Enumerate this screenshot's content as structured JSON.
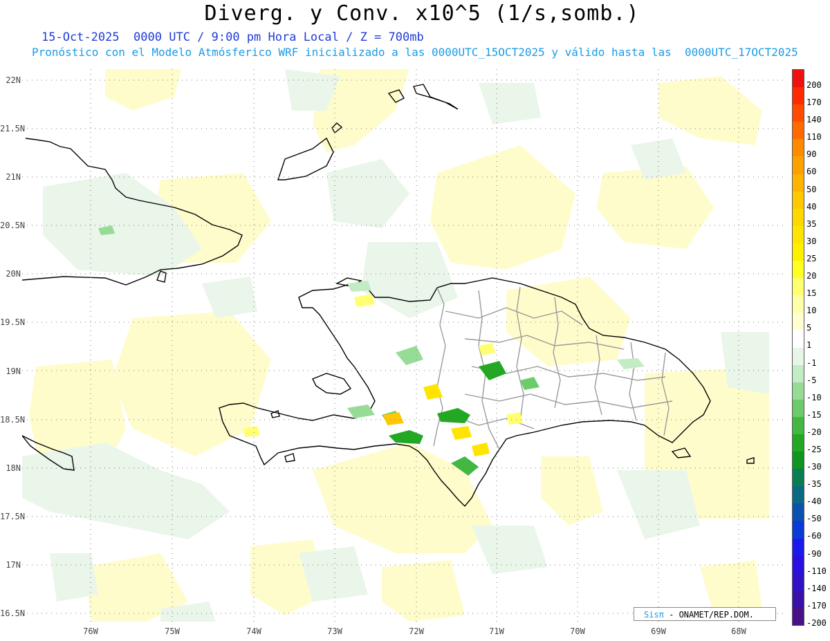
{
  "title": "Diverg. y Conv. x10^5 (1/s,somb.)",
  "subtitle_line1": "15-Oct-2025  0000 UTC / 9:00 pm Hora Local / Z = 700mb",
  "subtitle_line2": "Pronóstico con el Modelo Atmósferico WRF inicializado a las 0000UTC_15OCT2025 y válido hasta las  0000UTC_17OCT2025",
  "lat_labels": [
    "22N",
    "21.5N",
    "21N",
    "20.5N",
    "20N",
    "19.5N",
    "19N",
    "18.5N",
    "18N",
    "17.5N",
    "17N",
    "16.5N"
  ],
  "lon_labels": [
    "76W",
    "75W",
    "74W",
    "73W",
    "72W",
    "71W",
    "70W",
    "69W",
    "68W"
  ],
  "colorbar": {
    "labels": [
      "200",
      "170",
      "140",
      "110",
      "90",
      "60",
      "50",
      "40",
      "35",
      "30",
      "25",
      "20",
      "15",
      "10",
      "5",
      "1",
      "-1",
      "-5",
      "-10",
      "-15",
      "-20",
      "-25",
      "-30",
      "-35",
      "-40",
      "-50",
      "-60",
      "-90",
      "-110",
      "-140",
      "-170",
      "-200"
    ],
    "colors": [
      "#f01010",
      "#ff2a00",
      "#ff4a00",
      "#ff6a00",
      "#ff8a00",
      "#ffa000",
      "#ffb400",
      "#ffc800",
      "#ffd800",
      "#ffe400",
      "#fff000",
      "#ffff20",
      "#ffff70",
      "#ffffa8",
      "#ffffd0",
      "#ffffff",
      "#e8f6e8",
      "#c4ecc4",
      "#96dc96",
      "#6ccc6c",
      "#42b842",
      "#22a822",
      "#10961e",
      "#0a7e52",
      "#0a6a82",
      "#0a52b0",
      "#0a3ad8",
      "#1a1aef",
      "#2a10e0",
      "#3010c8",
      "#3a10a8",
      "#4a1088"
    ]
  },
  "credit": {
    "sis": "Sisπ",
    "rest": " - ONAMET/REP.DOM."
  }
}
